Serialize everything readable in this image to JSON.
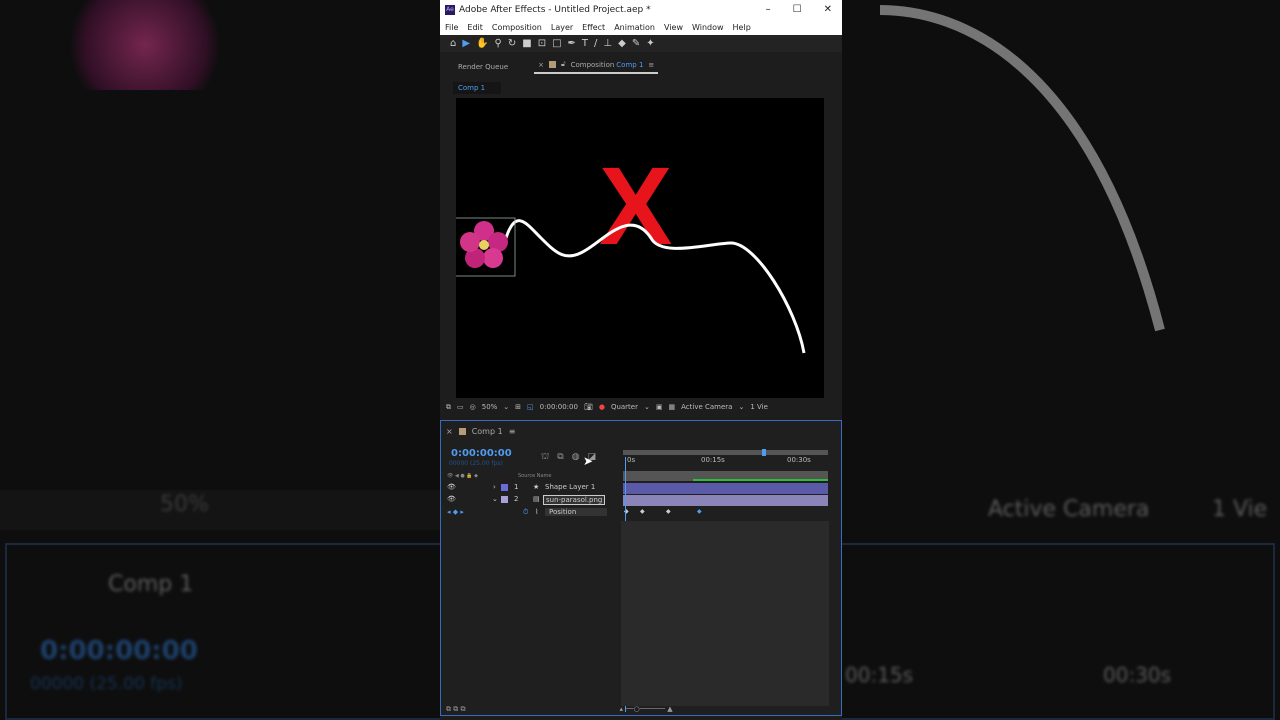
{
  "background_echo": {
    "zoom": "50%",
    "camera": "Active Camera",
    "views": "1 Vie",
    "comp": "Comp 1",
    "time": "0:00:00:00",
    "frames": "00000 (25.00 fps)",
    "t15": "00:15s",
    "t30": "00:30s"
  },
  "title": "Adobe After Effects - Untitled Project.aep *",
  "app_logo": "Ae",
  "menu": [
    "File",
    "Edit",
    "Composition",
    "Layer",
    "Effect",
    "Animation",
    "View",
    "Window",
    "Help"
  ],
  "tabs": {
    "render_queue": "Render Queue",
    "composition_prefix": "Composition",
    "composition_name": "Comp 1"
  },
  "comp_tab": "Comp 1",
  "viewer": {
    "zoom": "50%",
    "time": "0:00:00:00",
    "resolution": "Quarter",
    "camera": "Active Camera",
    "views": "1 Vie",
    "overlay_mark": "X"
  },
  "timeline": {
    "comp_name": "Comp 1",
    "current_time": "0:00:00:00",
    "frames": "00000 (25.00 fps)",
    "ruler": [
      "0s",
      "00:15s",
      "00:30s"
    ],
    "col_source": "Source Name",
    "col_num": "#",
    "layers": [
      {
        "num": "1",
        "name": "Shape Layer 1",
        "color": "#6b6bdc"
      },
      {
        "num": "2",
        "name": "sun-parasol.png",
        "color": "#a9a0d8"
      }
    ],
    "property": "Position"
  },
  "colors": {
    "accent": "#4f9cf0",
    "x_red": "#e8141b"
  }
}
